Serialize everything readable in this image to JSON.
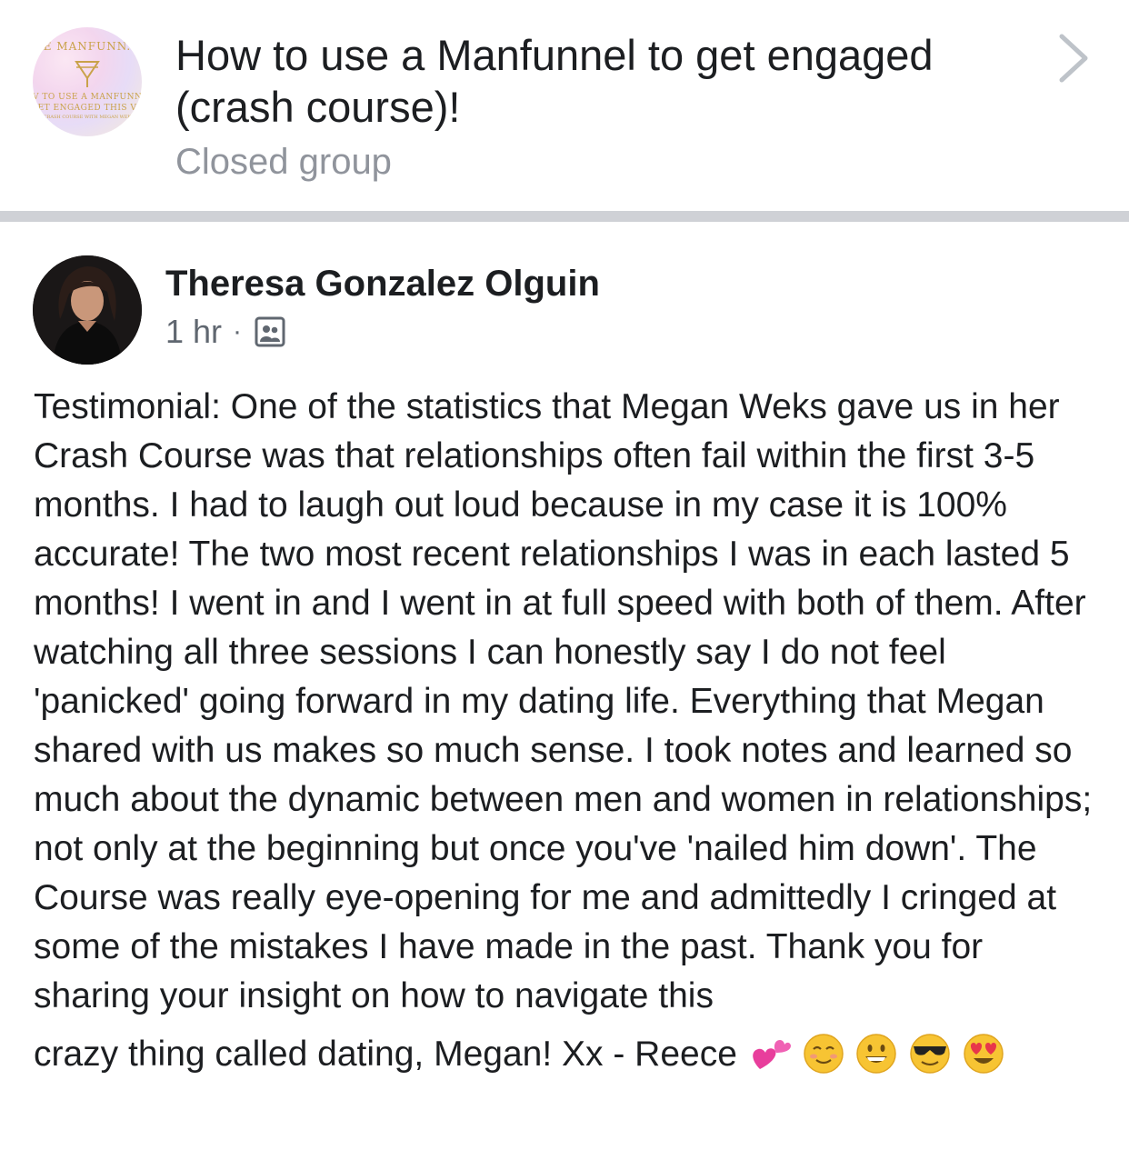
{
  "group": {
    "avatar_text_top": "E MANFUNN.",
    "avatar_text_mid1": "V TO USE A MANFUNN",
    "avatar_text_mid2": "ET ENGAGED THIS V",
    "avatar_text_small": "CRASH COURSE WITH MEGAN WEK",
    "title": "How to use a Manfunnel to get engaged (crash course)!",
    "subtitle": "Closed group",
    "chevron_icon": "chevron-right-icon"
  },
  "post": {
    "author_name": "Theresa Gonzalez Olguin",
    "time": "1 hr",
    "separator": "·",
    "privacy_icon": "group-members-icon",
    "body": "Testimonial: One of the statistics that Megan Weks gave us in her Crash Course was that relationships often fail within the first 3-5 months. I had to laugh out loud because in my case it is 100% accurate! The two most recent relationships I was in each lasted 5 months! I went in and I went in at full speed with both of them. After watching all three sessions I can honestly say I do not feel 'panicked' going forward in my dating life. Everything that Megan shared with us makes so much sense. I took notes and learned so much about the dynamic between men and women in relationships; not only at the beginning but once you've 'nailed him down'. The Course was really eye-opening for me and admittedly I cringed at some of the mistakes I have made in the past. Thank you for sharing your insight on how to navigate this",
    "last_line": "crazy thing called dating, Megan! Xx - Reece",
    "emojis": [
      "two-hearts-emoji",
      "smiling-blush-emoji",
      "grinning-emoji",
      "sunglasses-emoji",
      "heart-eyes-emoji"
    ]
  },
  "colors": {
    "divider": "#cfd1d6",
    "secondary_text": "#90949c",
    "meta_text": "#606770",
    "primary_text": "#1c1e21"
  }
}
